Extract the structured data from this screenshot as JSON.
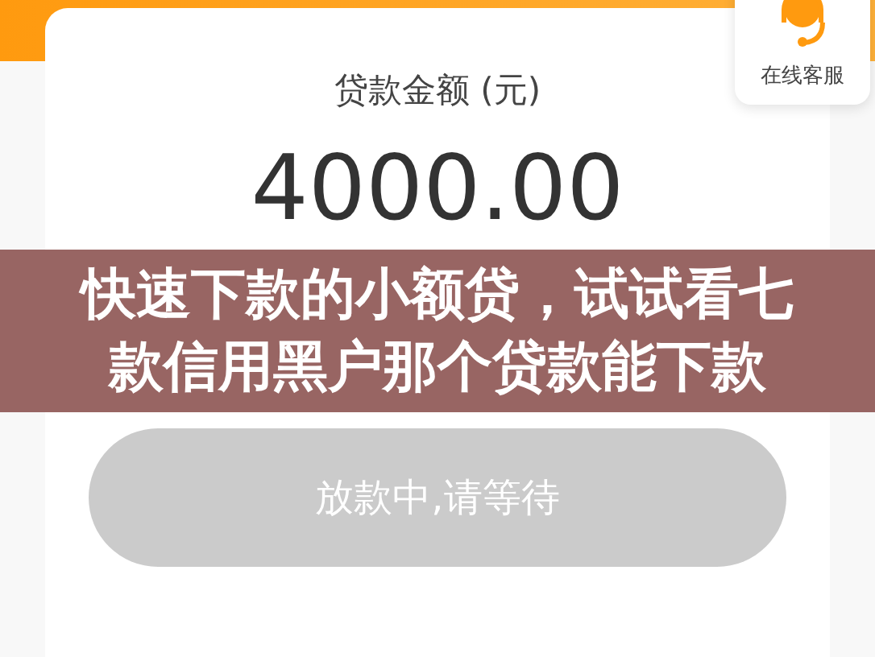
{
  "card": {
    "label": "贷款金额 (元)",
    "amount": "4000.00",
    "button": {
      "label": "放款中,请等待",
      "disabled": true
    }
  },
  "service": {
    "label": "在线客服"
  },
  "overlay": {
    "title": "快速下款的小额贷，试试看七款信用黑户那个贷款能下款"
  }
}
